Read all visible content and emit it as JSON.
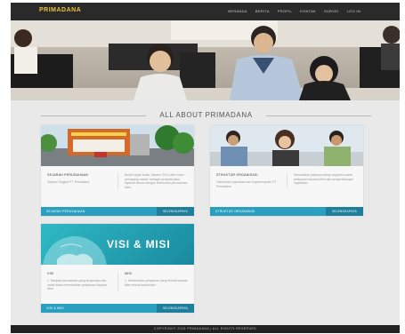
{
  "brand": {
    "name": "PRIMADANA"
  },
  "nav": {
    "items": [
      "BERANDA",
      "BERITA",
      "PROFIL",
      "KONTAK",
      "SURVEI",
      "LOG IN"
    ]
  },
  "section": {
    "title": "ALL ABOUT PRIMADANA"
  },
  "cards": [
    {
      "left_head": "SEJARAH PERUSAHAAN",
      "left_body": "Sejarah Singkat PT. Primadana",
      "right_body": "Berdiri sejak Bulan Oktober 2010 oleh enam pemegang saham sebagai penyedia jasa layanan sesuai dengan kebutuhan perusahaan klien.",
      "footer_label": "SEJARAH PERUSAHAAN",
      "more_label": "SELENGKAPNYA"
    },
    {
      "left_head": "STRUKTUR ORGANISASI",
      "left_body": "Tata kelola organisasi dan kepemimpinan PT. Primadana.",
      "right_body": "Memastikan jalannya setiap kegiatan usaha, pelayanan kepada klien dan pengembangan organisasi.",
      "footer_label": "STRUKTUR ORGANISASI",
      "more_label": "SELENGKAPNYA"
    },
    {
      "banner_title": "VISI & MISI",
      "left_head": "VISI",
      "left_body": "1. Menjadi perusahaan yang terpercaya dan andal dalam memberikan pelayanan kepada klien.",
      "right_head": "MISI",
      "right_body": "1. Memberikan pelayanan yang terbaik kepada klien sesuai kebutuhan.",
      "footer_label": "VISI & MISI",
      "more_label": "SELENGKAPNYA"
    }
  ],
  "footer": {
    "copyright": "COPYRIGHT 2015 PRIMADANA | ALL RIGHTS RESERVED"
  },
  "colors": {
    "accent": "#2a9fc0",
    "accent_dark": "#1e7f9d",
    "brand": "#e8c23a",
    "navbar": "#2a2a2a"
  }
}
